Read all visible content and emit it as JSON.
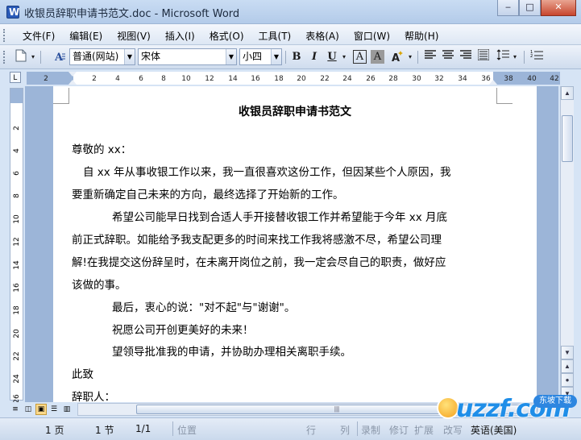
{
  "window": {
    "title": "收银员辞职申请书范文.doc - Microsoft Word",
    "controls": [
      "‒",
      "□",
      "✕"
    ]
  },
  "menu": [
    "文件(F)",
    "编辑(E)",
    "视图(V)",
    "插入(I)",
    "格式(O)",
    "工具(T)",
    "表格(A)",
    "窗口(W)",
    "帮助(H)"
  ],
  "toolbar": {
    "style_value": "普通(网站)",
    "font_value": "宋体",
    "size_value": "小四",
    "bold_label": "B",
    "italic_label": "I",
    "underline_label": "U",
    "char_border_label": "A",
    "char_shading_label": "A"
  },
  "ruler": {
    "h_ticks": [
      "2",
      "2",
      "4",
      "6",
      "8",
      "10",
      "12",
      "14",
      "16",
      "18",
      "20",
      "22",
      "24",
      "26",
      "28",
      "30",
      "32",
      "34",
      "36",
      "38",
      "40",
      "42"
    ],
    "v_ticks": [
      "2",
      "4",
      "6",
      "8",
      "10",
      "12",
      "14",
      "16",
      "18",
      "20",
      "22",
      "24",
      "26"
    ],
    "corner_label": "L"
  },
  "document": {
    "title": "收银员辞职申请书范文",
    "lines": [
      "尊敬的 xx：",
      "自 xx 年从事收银工作以来，我一直很喜欢这份工作，但因某些个人原因，我",
      "要重新确定自己未来的方向，最终选择了开始新的工作。",
      "希望公司能早日找到合适人手开接替收银工作并希望能于今年 xx 月底",
      "前正式辞职。如能给予我支配更多的时间来找工作我将感激不尽，希望公司理",
      "解!在我提交这份辞呈时，在未离开岗位之前，我一定会尽自己的职责，做好应",
      "该做的事。",
      "最后，衷心的说：\"对不起\"与\"谢谢\"。",
      "祝愿公司开创更美好的未来！",
      "望领导批准我的申请，并协助办理相关离职手续。",
      "此致",
      "辞职人："
    ]
  },
  "statusbar": {
    "page": "1 页",
    "section": "1 节",
    "page_of": "1/1",
    "position": "位置",
    "line": "行",
    "column": "列",
    "rec": "录制",
    "trk": "修订",
    "ext": "扩展",
    "ovr": "改写",
    "language": "英语(美国)"
  },
  "watermark": {
    "text": "uzzf.com",
    "badge": "东坡下载"
  }
}
